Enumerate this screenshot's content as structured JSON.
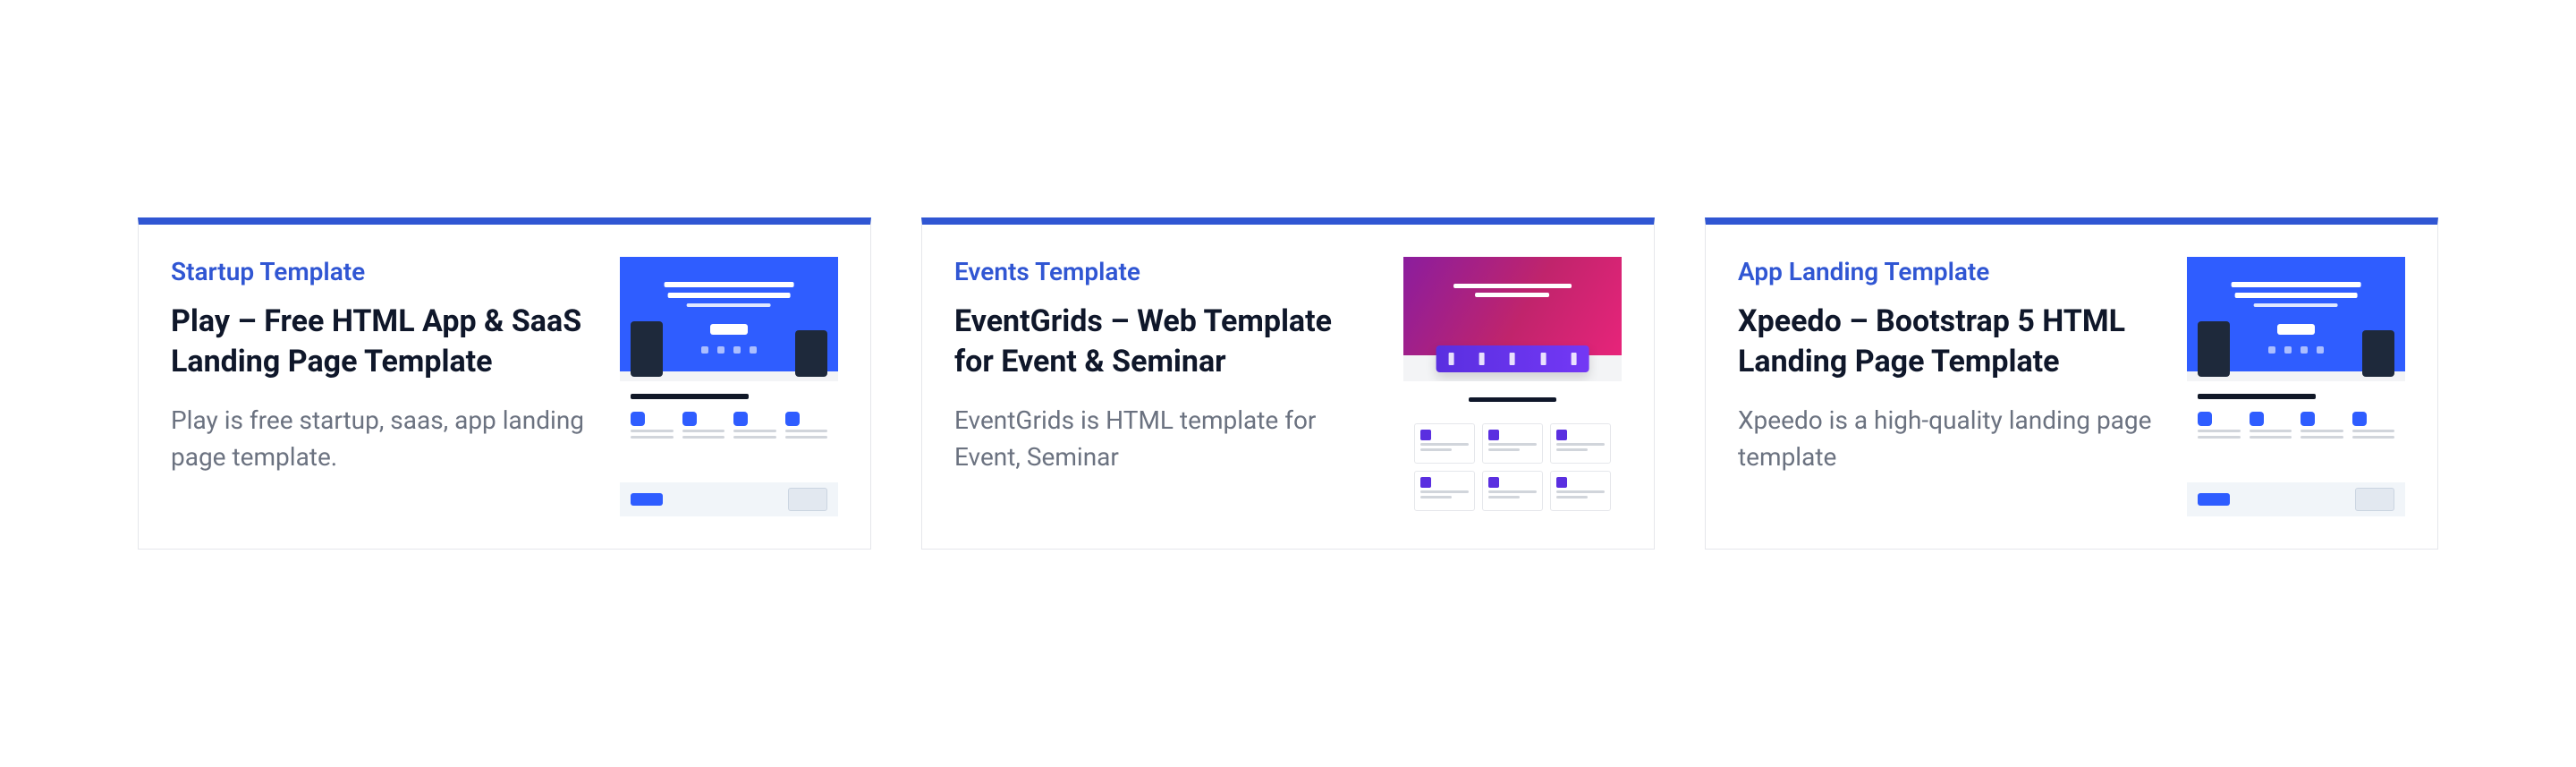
{
  "cards": [
    {
      "category": "Startup Template",
      "title": "Play – Free HTML App & SaaS Landing Page Template",
      "description": "Play is free startup, saas, app landing page template."
    },
    {
      "category": "Events Template",
      "title": "EventGrids – Web Template for Event & Seminar",
      "description": "EventGrids is HTML template for Event, Seminar"
    },
    {
      "category": "App Landing Template",
      "title": "Xpeedo – Bootstrap 5 HTML Landing Page Template",
      "description": "Xpeedo is a high-quality landing page template"
    }
  ]
}
